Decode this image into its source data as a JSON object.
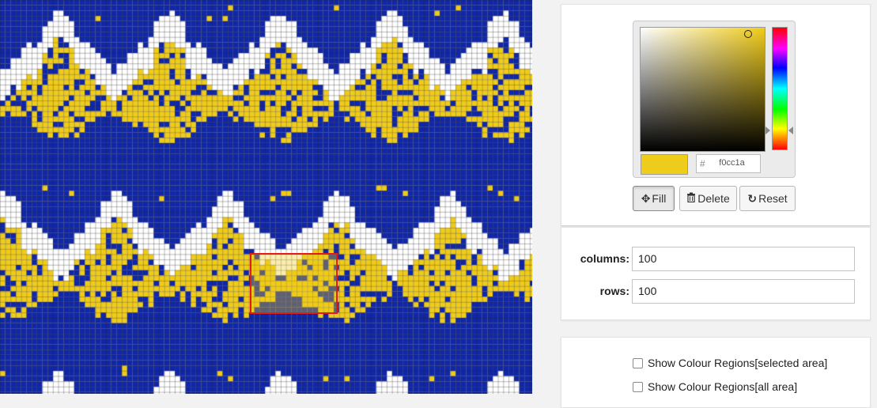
{
  "grid": {
    "columns": 100,
    "rows": 100,
    "colors": {
      "background": "#1027a8",
      "accent": "#f0cc1a",
      "empty": "#ffffff",
      "gridline": "#5a5a5a"
    }
  },
  "picker": {
    "hex_hash": "#",
    "hex_value": "f0cc1a",
    "current_color": "#f0cc1a"
  },
  "toolbar": {
    "fill_label": "Fill",
    "fill_icon": "move-arrows-icon",
    "delete_label": "Delete",
    "delete_icon": "trash-icon",
    "reset_label": "Reset",
    "reset_icon": "refresh-icon"
  },
  "size": {
    "columns_label": "columns:",
    "columns_value": "100",
    "rows_label": "rows:",
    "rows_value": "100"
  },
  "regions": {
    "selected_label": "Show Colour Regions[selected area]",
    "all_label": "Show Colour Regions[all area]"
  }
}
